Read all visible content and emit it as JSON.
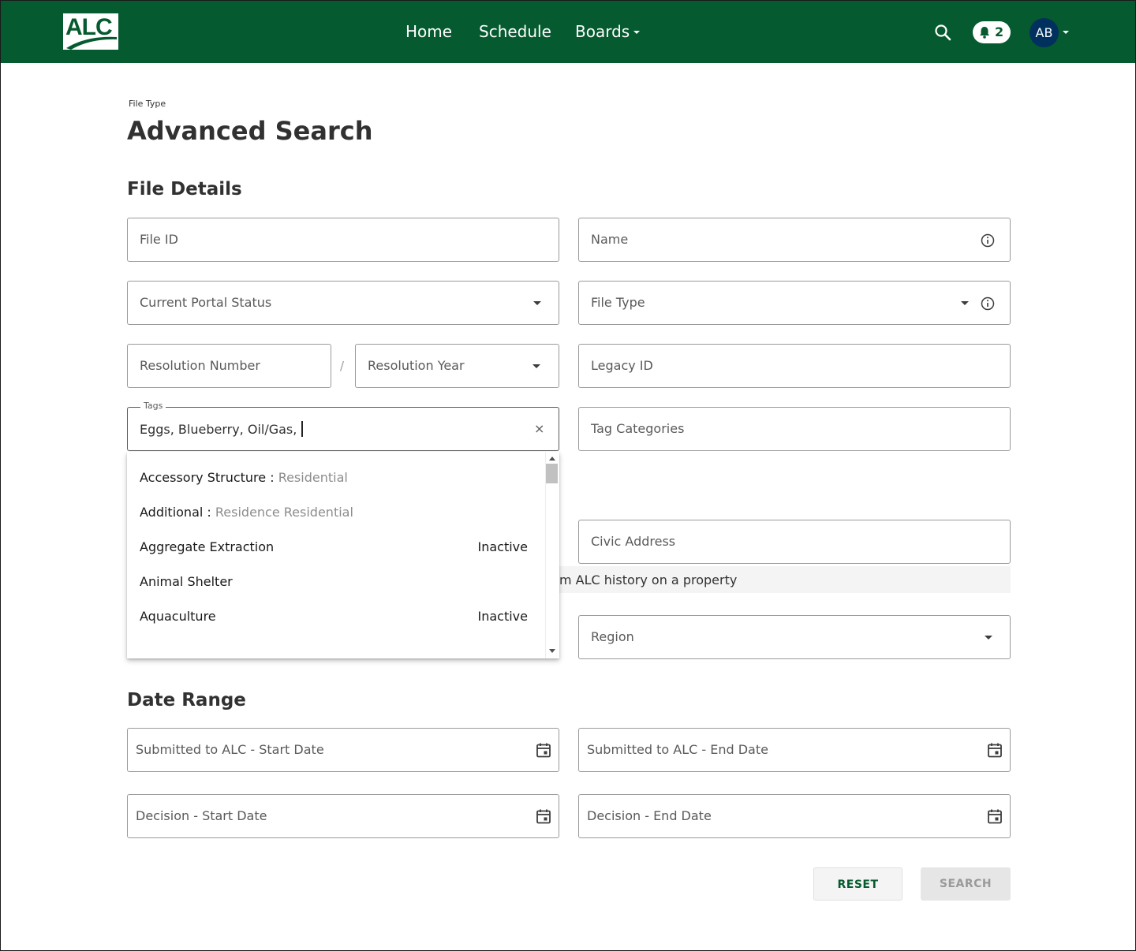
{
  "header": {
    "logo_text": "ALC",
    "nav": [
      {
        "label": "Home"
      },
      {
        "label": "Schedule"
      },
      {
        "label": "Boards"
      }
    ],
    "notifications_count": "2",
    "avatar_initials": "AB",
    "colors": {
      "primary": "#065a2f",
      "avatar": "#00305d"
    }
  },
  "page": {
    "breadcrumb": "File Type",
    "title": "Advanced Search"
  },
  "file_details": {
    "section_title": "File Details",
    "file_id_label": "File ID",
    "name_label": "Name",
    "portal_status_label": "Current Portal Status",
    "file_type_label": "File Type",
    "resolution_number_label": "Resolution Number",
    "resolution_separator": "/",
    "resolution_year_label": "Resolution Year",
    "legacy_id_label": "Legacy ID",
    "tags": {
      "label": "Tags",
      "value": "Eggs, Blueberry, Oil/Gas,",
      "clear": "×"
    },
    "tag_categories_label": "Tag Categories",
    "civic_address_label": "Civic Address",
    "hint_text": "m ALC history on a property",
    "region_label": "Region"
  },
  "tag_options": [
    {
      "label": "Accessory Structure : ",
      "sub": "Residential",
      "status": ""
    },
    {
      "label": "Additional : ",
      "sub": "Residence Residential",
      "status": ""
    },
    {
      "label": "Aggregate Extraction",
      "sub": "",
      "status": "Inactive"
    },
    {
      "label": "Animal Shelter",
      "sub": "",
      "status": ""
    },
    {
      "label": "Aquaculture",
      "sub": "",
      "status": "Inactive"
    }
  ],
  "date_range": {
    "section_title": "Date Range",
    "submitted_start": "Submitted to ALC - Start Date",
    "submitted_end": "Submitted to ALC - End Date",
    "decision_start": "Decision - Start Date",
    "decision_end": "Decision - End Date"
  },
  "actions": {
    "reset": "RESET",
    "search": "SEARCH"
  }
}
